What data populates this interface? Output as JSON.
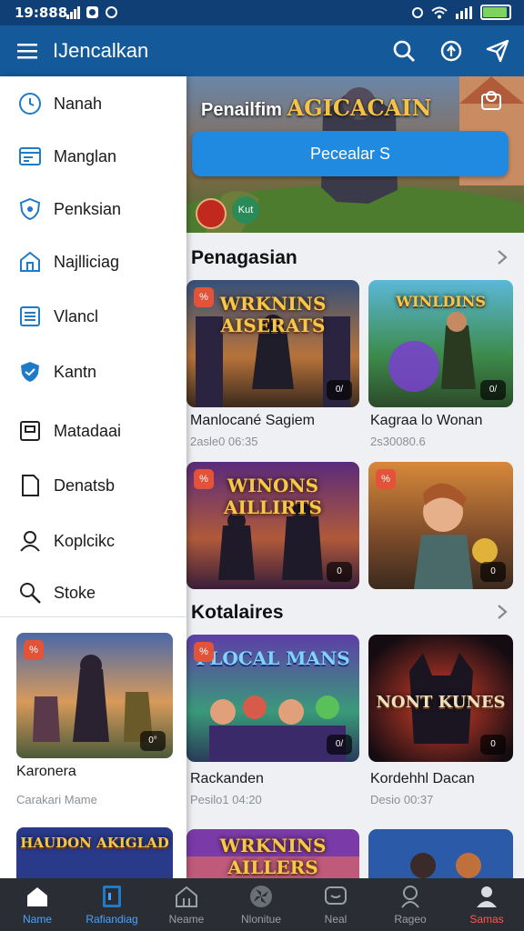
{
  "status_bar": {
    "time": "19:888",
    "colors": {
      "bar": "#0f3f75",
      "battery_fill": "#7dd35b"
    }
  },
  "app_bar": {
    "title": "IJencalkan",
    "color": "#145a9a",
    "icons": [
      "menu-icon",
      "search-icon",
      "sync-icon",
      "send-icon"
    ]
  },
  "drawer": {
    "items": [
      {
        "label": "Nanah",
        "icon": "clock-icon"
      },
      {
        "label": "Manglan",
        "icon": "list-card-icon"
      },
      {
        "label": "Penksian",
        "icon": "shield-chat-icon"
      },
      {
        "label": "Najlliciag",
        "icon": "house-icon"
      },
      {
        "label": "Vlancl",
        "icon": "document-list-icon"
      },
      {
        "label": "Kantn",
        "icon": "shield-icon"
      },
      {
        "label": "Matadaai",
        "icon": "frame-icon"
      },
      {
        "label": "Denatsb",
        "icon": "page-icon"
      },
      {
        "label": "Koplcikc",
        "icon": "user-icon"
      },
      {
        "label": "Stoke",
        "icon": "search-people-icon"
      }
    ],
    "featured": [
      {
        "title": "Karonera",
        "subtitle": "Carakari Mame",
        "badge_left": "%",
        "badge_right": "0°"
      },
      {
        "logo": "HAUDON AKIGLAD"
      }
    ]
  },
  "hero": {
    "title": "Penailfim",
    "brand": "AGICACAIN",
    "button": "Pecealar S",
    "chip": "Kut",
    "color": "#1f8ae0"
  },
  "sections": [
    {
      "title": "Penagasian",
      "cards": [
        {
          "title": "Manlocané Sagiem",
          "subtitle": "2asle0 06:35",
          "logo": "WRKNINS AISERATS",
          "badge_left": "%",
          "badge_right": "0/"
        },
        {
          "title": "Kagraa lo Wonan",
          "subtitle": "2s30080.6",
          "logo": "WINLDINS",
          "badge_left": "",
          "badge_right": "0/"
        },
        {
          "title": "",
          "subtitle": "",
          "logo": "WINONS AILLIRTS",
          "badge_left": "%",
          "badge_right": "0"
        },
        {
          "title": "",
          "subtitle": "",
          "logo": "",
          "badge_left": "%",
          "badge_right": "0"
        }
      ]
    },
    {
      "title": "Kotalaires",
      "cards": [
        {
          "title": "Rackanden",
          "subtitle": "Pesilo1 04:20",
          "logo": "PLOCAL MANS",
          "badge_left": "%",
          "badge_right": "0/"
        },
        {
          "title": "Kordehhl Dacan",
          "subtitle": "Desio 00:37",
          "logo": "NONT KUNES",
          "badge_left": "",
          "badge_right": "0"
        },
        {
          "title": "",
          "subtitle": "",
          "logo": "WRKNINS AILLERS",
          "badge_left": "",
          "badge_right": ""
        },
        {
          "title": "",
          "subtitle": "",
          "logo": "",
          "badge_left": "",
          "badge_right": ""
        }
      ]
    }
  ],
  "bottom_nav": [
    {
      "label": "Name",
      "icon": "home-icon",
      "state": "active"
    },
    {
      "label": "Rafiandiag",
      "icon": "tablet-icon",
      "state": "active"
    },
    {
      "label": "Neame",
      "icon": "house-outline-icon",
      "state": ""
    },
    {
      "label": "Nlonitue",
      "icon": "pinwheel-icon",
      "state": ""
    },
    {
      "label": "Neal",
      "icon": "chat-bubble-icon",
      "state": ""
    },
    {
      "label": "Rageo",
      "icon": "person-pin-icon",
      "state": ""
    },
    {
      "label": "Samas",
      "icon": "profile-icon",
      "state": "alert"
    }
  ],
  "colors": {
    "active_nav": "#4aa3ff",
    "alert_nav": "#ff5a4e",
    "nav_bg": "#2a2d33"
  }
}
